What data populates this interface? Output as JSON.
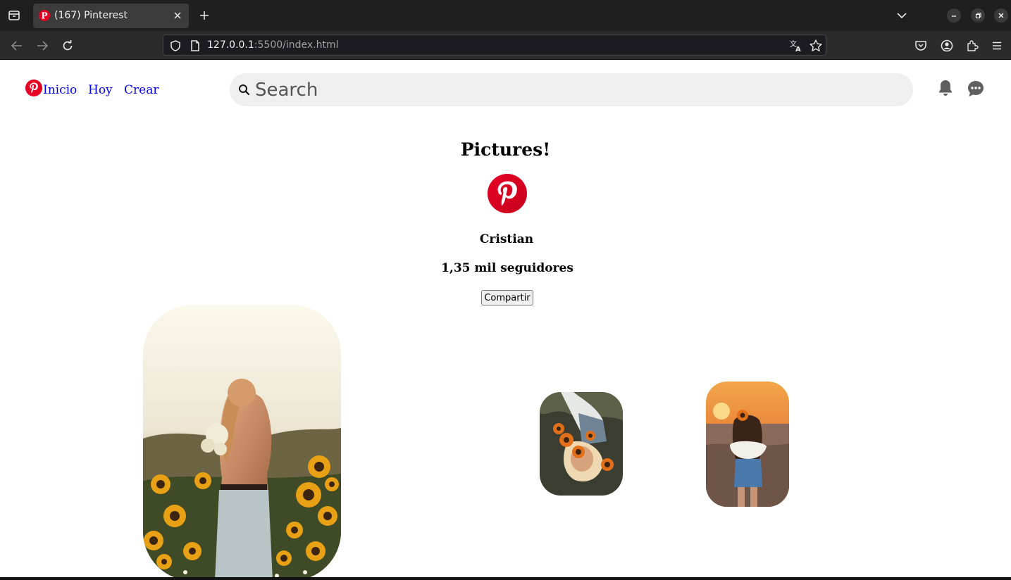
{
  "browser": {
    "tab": {
      "title": "(167) Pinterest"
    },
    "url": {
      "host": "127.0.0.1",
      "rest": ":5500/index.html"
    }
  },
  "header": {
    "nav": [
      {
        "label": "Inicio"
      },
      {
        "label": "Hoy"
      },
      {
        "label": "Crear"
      }
    ],
    "search": {
      "placeholder": "Search",
      "value": ""
    }
  },
  "profile": {
    "title": "Pictures!",
    "name": "Cristian",
    "followers": "1,35 mil seguidores",
    "share_label": "Compartir"
  },
  "colors": {
    "pinterest_red": "#e60023",
    "link": "#0000ee",
    "search_bg": "#efefef"
  },
  "icons": [
    "tab-list-icon",
    "pinterest-icon",
    "close-icon",
    "plus-icon",
    "chevron-down-icon",
    "back-icon",
    "forward-icon",
    "reload-icon",
    "shield-icon",
    "page-icon",
    "translate-icon",
    "star-icon",
    "pocket-icon",
    "account-icon",
    "extensions-icon",
    "menu-icon",
    "search-icon",
    "bell-icon",
    "chat-icon"
  ],
  "pins": [
    {
      "subject": "woman-in-sunflower-field"
    },
    {
      "subject": "woman-lying-with-sunflowers"
    },
    {
      "subject": "woman-in-field-at-sunset"
    }
  ]
}
